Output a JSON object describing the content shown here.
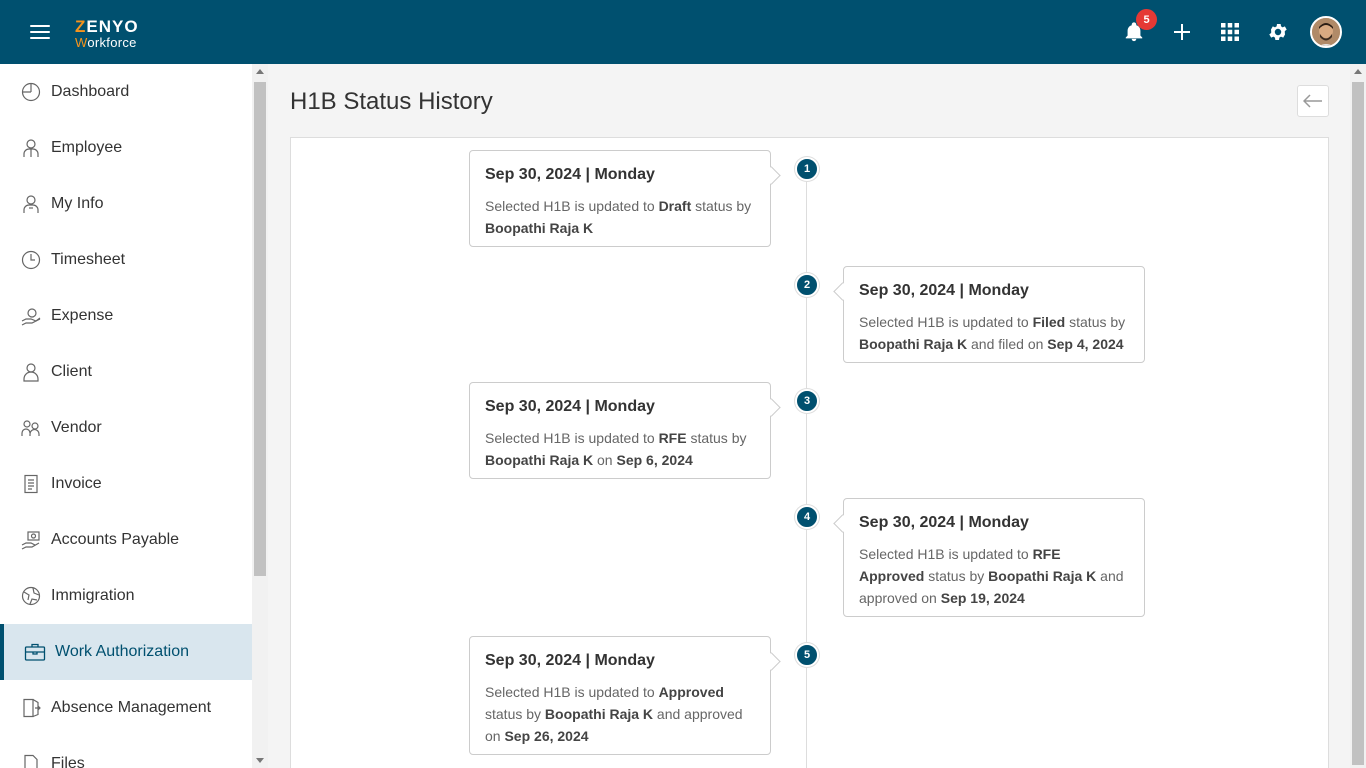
{
  "header": {
    "logo_top": "ZENYO",
    "logo_bottom": "Workforce",
    "notification_count": "5",
    "icons": [
      "menu-icon",
      "bell-icon",
      "plus-icon",
      "apps-grid-icon",
      "gear-icon",
      "avatar"
    ]
  },
  "sidebar": {
    "items": [
      {
        "label": "Dashboard",
        "icon": "dashboard-icon"
      },
      {
        "label": "Employee",
        "icon": "employee-icon"
      },
      {
        "label": "My Info",
        "icon": "my-info-icon"
      },
      {
        "label": "Timesheet",
        "icon": "clock-icon"
      },
      {
        "label": "Expense",
        "icon": "expense-icon"
      },
      {
        "label": "Client",
        "icon": "client-icon"
      },
      {
        "label": "Vendor",
        "icon": "vendor-icon"
      },
      {
        "label": "Invoice",
        "icon": "invoice-icon"
      },
      {
        "label": "Accounts Payable",
        "icon": "accounts-payable-icon"
      },
      {
        "label": "Immigration",
        "icon": "immigration-icon"
      },
      {
        "label": "Work Authorization",
        "icon": "briefcase-icon",
        "active": true
      },
      {
        "label": "Absence Management",
        "icon": "absence-icon"
      },
      {
        "label": "Files",
        "icon": "files-icon"
      }
    ]
  },
  "page": {
    "title": "H1B Status History"
  },
  "timeline": [
    {
      "num": "1",
      "date": "Sep 30, 2024 | Monday",
      "parts": [
        [
          "t",
          "Selected H1B is updated to "
        ],
        [
          "b",
          "Draft"
        ],
        [
          "t",
          " status by "
        ],
        [
          "b",
          "Boopathi Raja K"
        ]
      ]
    },
    {
      "num": "2",
      "date": "Sep 30, 2024 | Monday",
      "parts": [
        [
          "t",
          "Selected H1B is updated to "
        ],
        [
          "b",
          "Filed"
        ],
        [
          "t",
          " status by "
        ],
        [
          "b",
          "Boopathi Raja K"
        ],
        [
          "t",
          " and filed on "
        ],
        [
          "b",
          "Sep 4, 2024"
        ]
      ]
    },
    {
      "num": "3",
      "date": "Sep 30, 2024 | Monday",
      "parts": [
        [
          "t",
          "Selected H1B is updated to "
        ],
        [
          "b",
          "RFE"
        ],
        [
          "t",
          " status by "
        ],
        [
          "b",
          "Boopathi Raja K"
        ],
        [
          "t",
          " on "
        ],
        [
          "b",
          "Sep 6, 2024"
        ]
      ]
    },
    {
      "num": "4",
      "date": "Sep 30, 2024 | Monday",
      "parts": [
        [
          "t",
          "Selected H1B is updated to "
        ],
        [
          "b",
          "RFE Approved"
        ],
        [
          "t",
          " status by "
        ],
        [
          "b",
          "Boopathi Raja K"
        ],
        [
          "t",
          " and approved on "
        ],
        [
          "b",
          "Sep 19, 2024"
        ]
      ]
    },
    {
      "num": "5",
      "date": "Sep 30, 2024 | Monday",
      "parts": [
        [
          "t",
          "Selected H1B is updated to "
        ],
        [
          "b",
          "Approved"
        ],
        [
          "t",
          " status by "
        ],
        [
          "b",
          "Boopathi Raja K"
        ],
        [
          "t",
          " and approved on "
        ],
        [
          "b",
          "Sep 26, 2024"
        ]
      ]
    }
  ],
  "colors": {
    "brand": "#00506f",
    "accent": "#f7941d",
    "badge": "#e53935"
  }
}
